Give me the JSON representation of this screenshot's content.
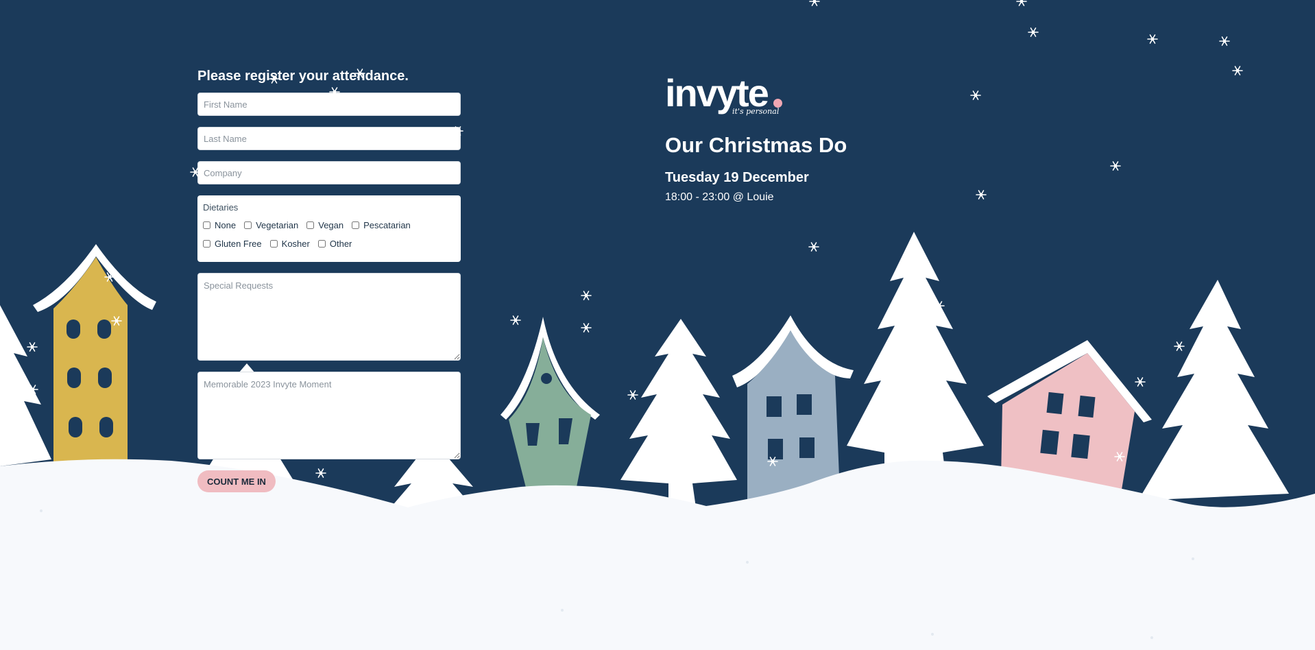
{
  "form": {
    "heading": "Please register your attendance.",
    "first_name_placeholder": "First Name",
    "last_name_placeholder": "Last Name",
    "company_placeholder": "Company",
    "dietaries": {
      "title": "Dietaries",
      "options": [
        "None",
        "Vegetarian",
        "Vegan",
        "Pescatarian",
        "Gluten Free",
        "Kosher",
        "Other"
      ]
    },
    "special_requests_placeholder": "Special Requests",
    "memorable_moment_placeholder": "Memorable 2023 Invyte Moment",
    "submit_label": "COUNT ME IN"
  },
  "brand": {
    "logo_text": "invyte",
    "tagline": "it's personal"
  },
  "event": {
    "title": "Our Christmas Do",
    "date": "Tuesday 19 December",
    "time_venue": "18:00 - 23:00 @ Louie"
  },
  "colors": {
    "background": "#1b3a5a",
    "snow": "#f7f9fc",
    "house_yellow": "#d9b64f",
    "house_green": "#86ae99",
    "house_blue": "#9aafc2",
    "house_pink": "#efc0c4",
    "button": "#f0bcc1",
    "logo_dot": "#f0a7b3"
  }
}
